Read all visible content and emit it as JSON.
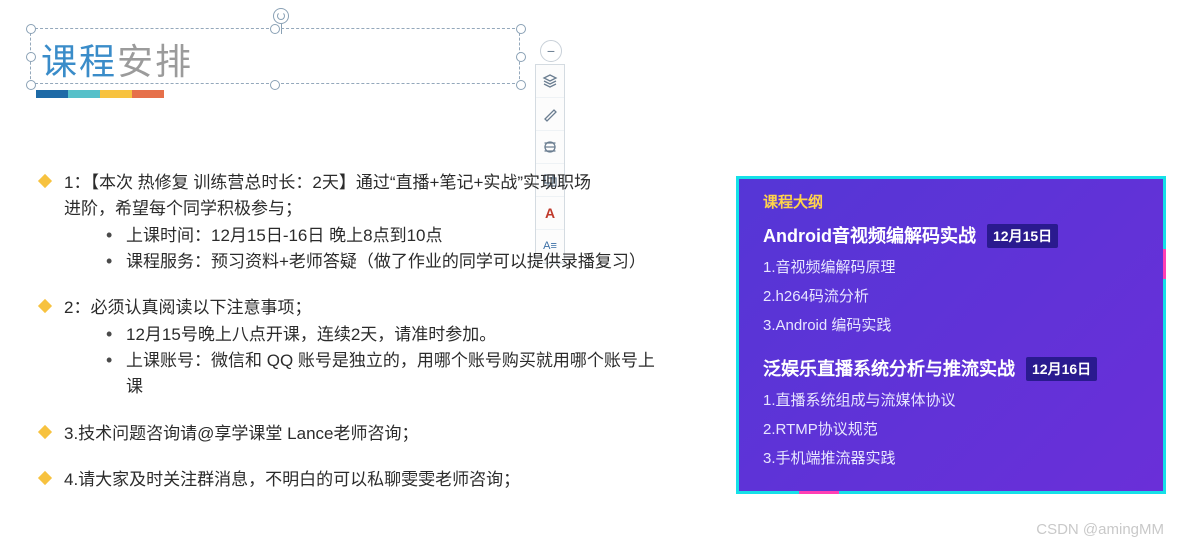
{
  "title": {
    "part1": "课程",
    "part2": "安排"
  },
  "underline_colors": [
    "#1e6aa6",
    "#56c0c9",
    "#f7c23f",
    "#e6704a"
  ],
  "toolbar": {
    "zoom_out": "−",
    "tools": [
      "layers",
      "brush",
      "align",
      "copy",
      "text",
      "style"
    ]
  },
  "content": {
    "item1_line1": "1：【本次 热修复 训练营总时长：2天】通过“直播+笔记+实战”实现职场",
    "item1_line2": "进阶，希望每个同学积极参与；",
    "item1_sub1": "上课时间：12月15日-16日 晚上8点到10点",
    "item1_sub2": "课程服务：预习资料+老师答疑（做了作业的同学可以提供录播复习）",
    "item2_line1": "2：必须认真阅读以下注意事项；",
    "item2_sub1": "12月15号晚上八点开课，连续2天，请准时参加。",
    "item2_sub2_a": "上课账号：微信和 QQ 账号是独立的，用哪个账号购买就用哪个账号上",
    "item2_sub2_b": "课",
    "item3": "3.技术问题咨询请@享学课堂 Lance老师咨询；",
    "item4": "4.请大家及时关注群消息，不明白的可以私聊雯雯老师咨询；"
  },
  "card": {
    "header": "课程大纲",
    "section1": {
      "title": "Android音视频编解码实战",
      "date": "12月15日",
      "rows": [
        "1.音视频编解码原理",
        "2.h264码流分析",
        "3.Android 编码实践"
      ]
    },
    "section2": {
      "title": "泛娱乐直播系统分析与推流实战",
      "date": "12月16日",
      "rows": [
        "1.直播系统组成与流媒体协议",
        "2.RTMP协议规范",
        "3.手机端推流器实践"
      ]
    }
  },
  "watermark": "CSDN @amingMM"
}
